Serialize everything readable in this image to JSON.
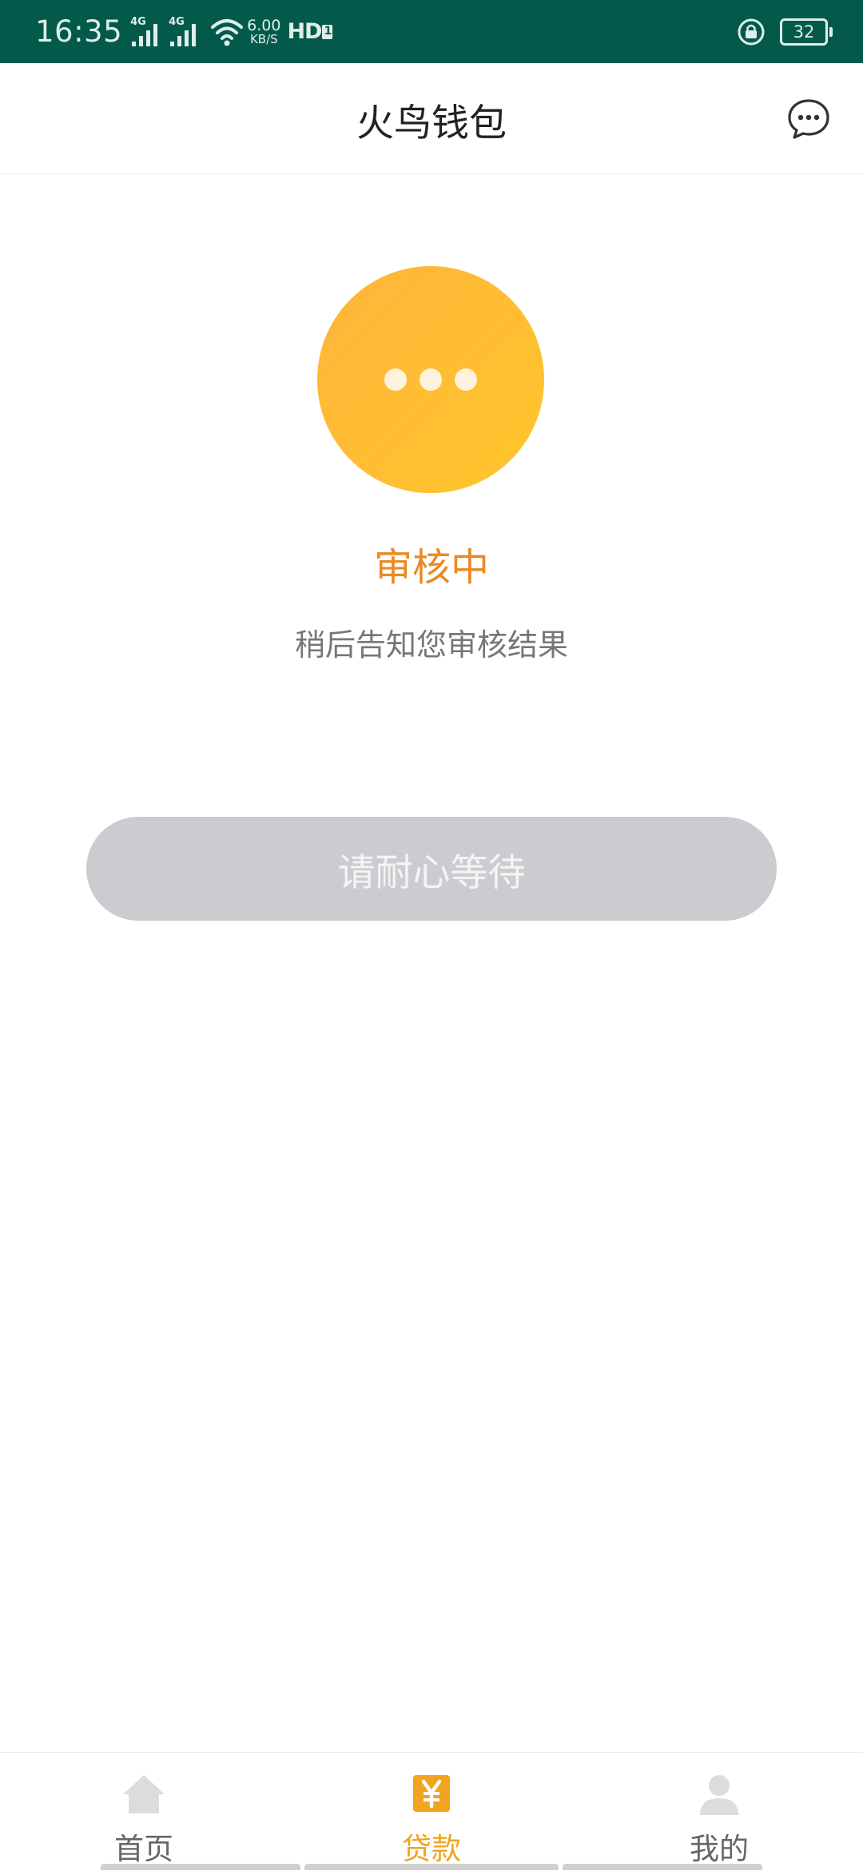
{
  "status_bar": {
    "time": "16:35",
    "sim1_label": "4G",
    "sim2_label": "4G",
    "net_speed_value": "6.00",
    "net_speed_unit": "KB/S",
    "hd_label": "HD",
    "hd_sub": "1",
    "battery_level": "32",
    "icons": [
      "signal-icon",
      "signal-icon",
      "wifi-icon",
      "hd-voice-icon",
      "orientation-lock-icon",
      "battery-icon"
    ]
  },
  "header": {
    "title": "火鸟钱包",
    "message_icon": "chat-bubble-icon"
  },
  "status": {
    "icon": "pending-dots-icon",
    "title": "审核中",
    "description": "稍后告知您审核结果",
    "button_label": "请耐心等待",
    "button_enabled": false
  },
  "bottom_nav": {
    "items": [
      {
        "label": "首页",
        "icon": "home-icon",
        "active": false
      },
      {
        "label": "贷款",
        "icon": "yen-loan-icon",
        "active": true
      },
      {
        "label": "我的",
        "icon": "user-icon",
        "active": false
      }
    ]
  },
  "colors": {
    "status_bar_bg": "#035a4b",
    "accent_orange": "#e98a26",
    "circle_yellow": "#ffbf32",
    "nav_active": "#f0a41f",
    "button_disabled": "#cbcccf",
    "nav_inactive_icon": "#dcdcdc"
  }
}
